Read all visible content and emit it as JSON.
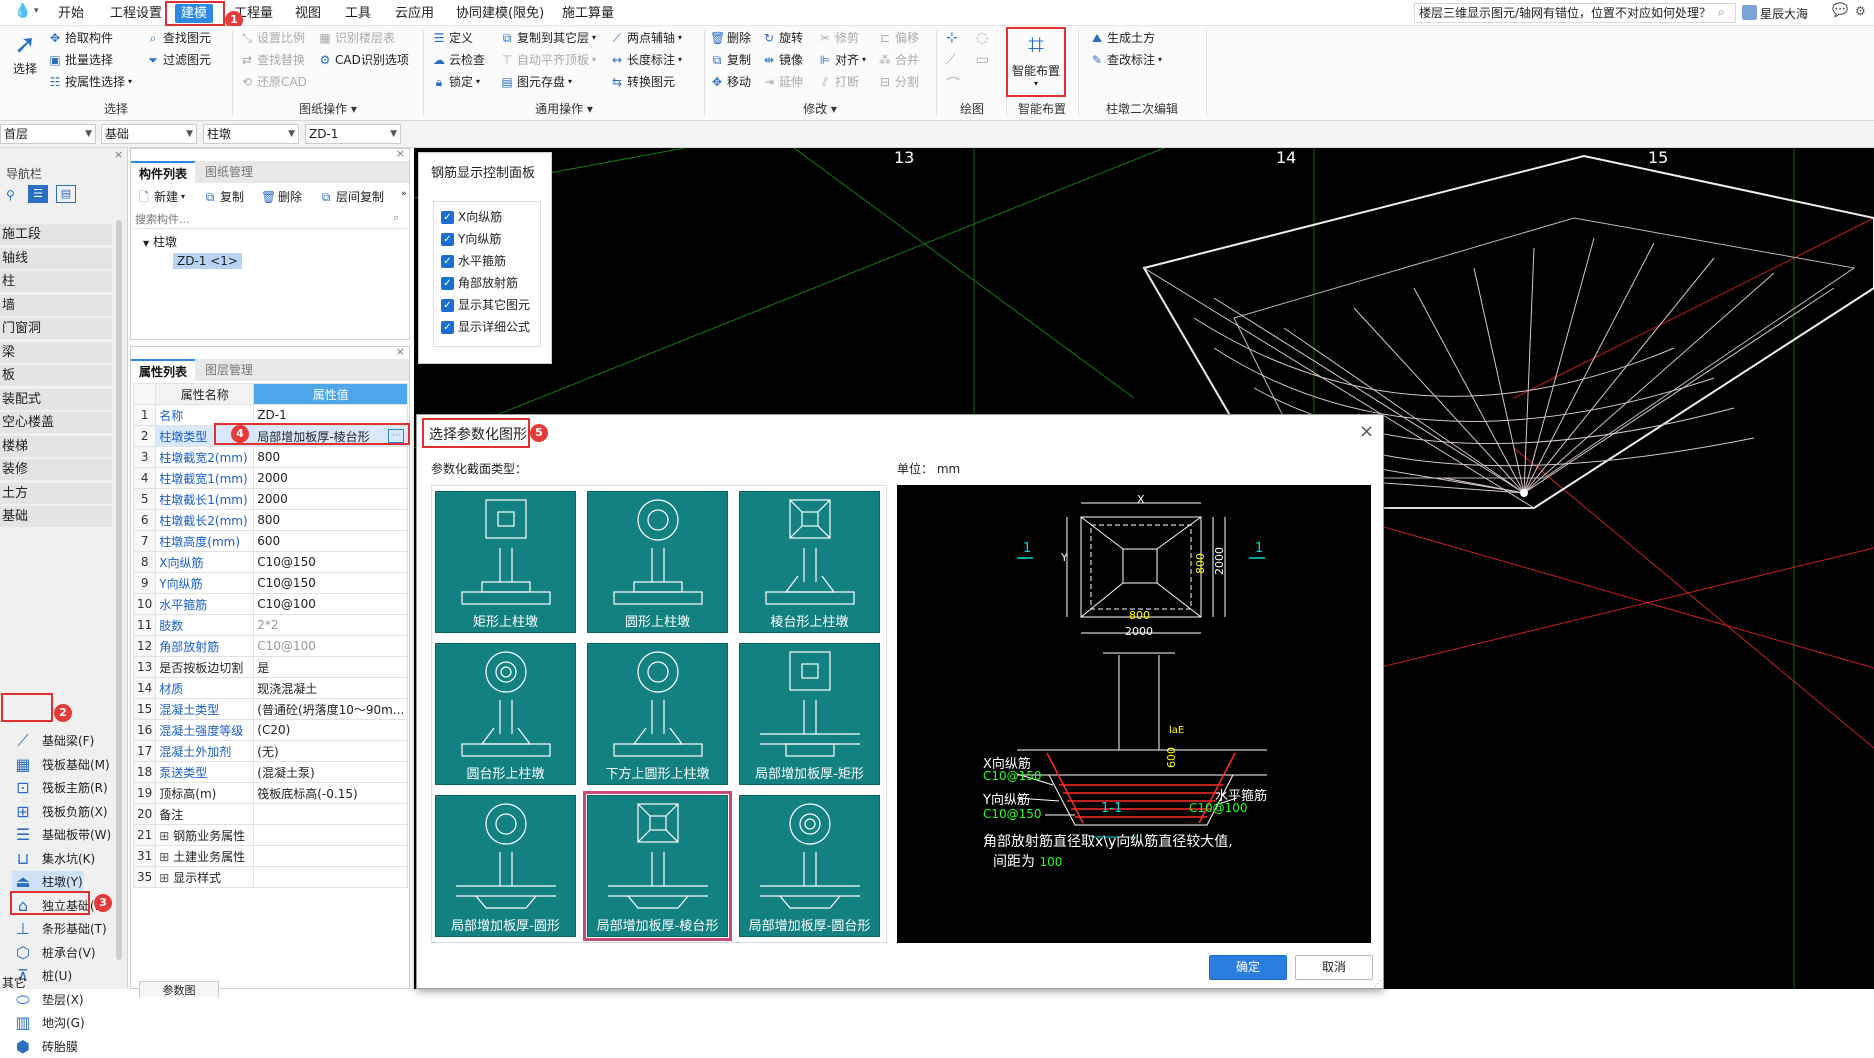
{
  "menu": {
    "items": [
      "开始",
      "工程设置",
      "建模",
      "工程量",
      "视图",
      "工具",
      "云应用",
      "协同建模(限免)",
      "施工算量"
    ],
    "active": "建模",
    "search_text": "楼层三维显示图元/轴网有错位，位置不对应如何处理？",
    "user": "星辰大海"
  },
  "ribbon": {
    "select_group": {
      "big": "选择",
      "items": [
        "拾取构件",
        "批量选择",
        "按属性选择",
        "查找图元",
        "过滤图元"
      ],
      "label": "选择"
    },
    "drawing_ops": {
      "items": [
        "设置比例",
        "查找替换",
        "还原CAD",
        "识别楼层表",
        "CAD识别选项"
      ],
      "label": "图纸操作"
    },
    "common_ops": {
      "items": [
        "定义",
        "云检查",
        "锁定",
        "复制到其它层",
        "自动平齐顶板",
        "图元存盘",
        "两点辅轴",
        "长度标注",
        "转换图元"
      ],
      "label": "通用操作"
    },
    "modify": {
      "items": [
        "删除",
        "复制",
        "移动",
        "旋转",
        "镜像",
        "延伸",
        "修剪",
        "对齐",
        "打断",
        "偏移",
        "合并",
        "分割"
      ],
      "label": "修改"
    },
    "draw": {
      "label": "绘图"
    },
    "smart": {
      "big": "智能布置",
      "label": "智能布置"
    },
    "pier_edit": {
      "items": [
        "生成土方",
        "查改标注"
      ],
      "label": "柱墩二次编辑"
    }
  },
  "selectors": [
    "首层",
    "基础",
    "柱墩",
    "ZD-1"
  ],
  "nav": {
    "title": "导航栏",
    "categories": [
      "施工段",
      "轴线",
      "柱",
      "墙",
      "门窗洞",
      "梁",
      "板",
      "装配式",
      "空心楼盖",
      "楼梯",
      "装修",
      "土方",
      "基础"
    ],
    "sub": [
      "基础梁(F)",
      "筏板基础(M)",
      "筏板主筋(R)",
      "筏板负筋(X)",
      "基础板带(W)",
      "集水坑(K)",
      "柱墩(Y)",
      "独立基础(D)",
      "条形基础(T)",
      "桩承台(V)",
      "桩(U)",
      "垫层(X)",
      "地沟(G)",
      "砖胎膜"
    ],
    "other": "其它"
  },
  "component_list": {
    "tabs": [
      "构件列表",
      "图纸管理"
    ],
    "tools": [
      "新建",
      "复制",
      "删除",
      "层间复制"
    ],
    "search_placeholder": "搜索构件...",
    "tree_root": "柱墩",
    "tree_item": "ZD-1 <1>"
  },
  "property_list": {
    "tabs": [
      "属性列表",
      "图层管理"
    ],
    "headers": [
      "属性名称",
      "属性值"
    ],
    "rows": [
      {
        "n": "1",
        "k": "名称",
        "v": "ZD-1",
        "kb": true,
        "vg": false
      },
      {
        "n": "2",
        "k": "柱墩类型",
        "v": "局部增加板厚-棱台形",
        "kb": true,
        "vg": false
      },
      {
        "n": "3",
        "k": "柱墩截宽2(mm)",
        "v": "800",
        "kb": true,
        "vg": false
      },
      {
        "n": "4",
        "k": "柱墩截宽1(mm)",
        "v": "2000",
        "kb": true,
        "vg": false
      },
      {
        "n": "5",
        "k": "柱墩截长1(mm)",
        "v": "2000",
        "kb": true,
        "vg": false
      },
      {
        "n": "6",
        "k": "柱墩截长2(mm)",
        "v": "800",
        "kb": true,
        "vg": false
      },
      {
        "n": "7",
        "k": "柱墩高度(mm)",
        "v": "600",
        "kb": true,
        "vg": false
      },
      {
        "n": "8",
        "k": "X向纵筋",
        "v": "C10@150",
        "kb": true,
        "vg": false
      },
      {
        "n": "9",
        "k": "Y向纵筋",
        "v": "C10@150",
        "kb": true,
        "vg": false
      },
      {
        "n": "10",
        "k": "水平箍筋",
        "v": "C10@100",
        "kb": true,
        "vg": false
      },
      {
        "n": "11",
        "k": "肢数",
        "v": "2*2",
        "kb": true,
        "vg": true
      },
      {
        "n": "12",
        "k": "角部放射筋",
        "v": "C10@100",
        "kb": true,
        "vg": true
      },
      {
        "n": "13",
        "k": "是否按板边切割",
        "v": "是",
        "kb": false,
        "vg": false
      },
      {
        "n": "14",
        "k": "材质",
        "v": "现浇混凝土",
        "kb": true,
        "vg": false
      },
      {
        "n": "15",
        "k": "混凝土类型",
        "v": "(普通砼(坍落度10～90m...",
        "kb": true,
        "vg": false
      },
      {
        "n": "16",
        "k": "混凝土强度等级",
        "v": "(C20)",
        "kb": true,
        "vg": false
      },
      {
        "n": "17",
        "k": "混凝土外加剂",
        "v": "(无)",
        "kb": true,
        "vg": false
      },
      {
        "n": "18",
        "k": "泵送类型",
        "v": "(混凝土泵)",
        "kb": true,
        "vg": false
      },
      {
        "n": "19",
        "k": "顶标高(m)",
        "v": "筏板底标高(-0.15)",
        "kb": false,
        "vg": false
      },
      {
        "n": "20",
        "k": "备注",
        "v": "",
        "kb": false,
        "vg": false
      },
      {
        "n": "21",
        "k": "钢筋业务属性",
        "v": "",
        "kb": false,
        "vg": false,
        "exp": true
      },
      {
        "n": "31",
        "k": "土建业务属性",
        "v": "",
        "kb": false,
        "vg": false,
        "exp": true
      },
      {
        "n": "35",
        "k": "显示样式",
        "v": "",
        "kb": false,
        "vg": false,
        "exp": true
      }
    ],
    "bottom_tab": "参数图"
  },
  "control_panel": {
    "title": "钢筋显示控制面板",
    "items": [
      "X向纵筋",
      "Y向纵筋",
      "水平箍筋",
      "角部放射筋",
      "显示其它图元",
      "显示详细公式"
    ]
  },
  "viewport": {
    "axis_labels": [
      "13",
      "14",
      "15"
    ]
  },
  "dialog": {
    "title": "选择参数化图形",
    "section_label": "参数化截面类型：",
    "unit_label": "单位：",
    "unit": "mm",
    "tiles": [
      "矩形上柱墩",
      "圆形上柱墩",
      "棱台形上柱墩",
      "圆台形上柱墩",
      "下方上圆形上柱墩",
      "局部增加板厚-矩形",
      "局部增加板厚-圆形",
      "局部增加板厚-棱台形",
      "局部增加板厚-圆台形"
    ],
    "selected_tile": "局部增加板厚-棱台形",
    "preview": {
      "dim_x": "X",
      "dim_y": "Y",
      "dim_800_a": "800",
      "dim_2000_a": "2000",
      "dim_800_b": "800",
      "dim_2000_b": "2000",
      "sec_1": "1",
      "sec_1b": "1",
      "dim_600": "600",
      "dim_lae": "laE",
      "x_label": "X向纵筋",
      "x_val": "C10@150",
      "y_label": "Y向纵筋",
      "y_val": "C10@150",
      "h_label": "水平箍筋",
      "h_val": "C10@100",
      "section_title": "1-1",
      "note_line1": "角部放射筋直径取x\\y向纵筋直径较大值,",
      "note_line2": "间距为",
      "note_val": "100"
    },
    "ok": "确定",
    "cancel": "取消"
  },
  "annotations": [
    "1",
    "2",
    "3",
    "4",
    "5"
  ],
  "colors": {
    "accent": "#2b8ae3",
    "teal": "#138182",
    "red": "#e03030"
  }
}
